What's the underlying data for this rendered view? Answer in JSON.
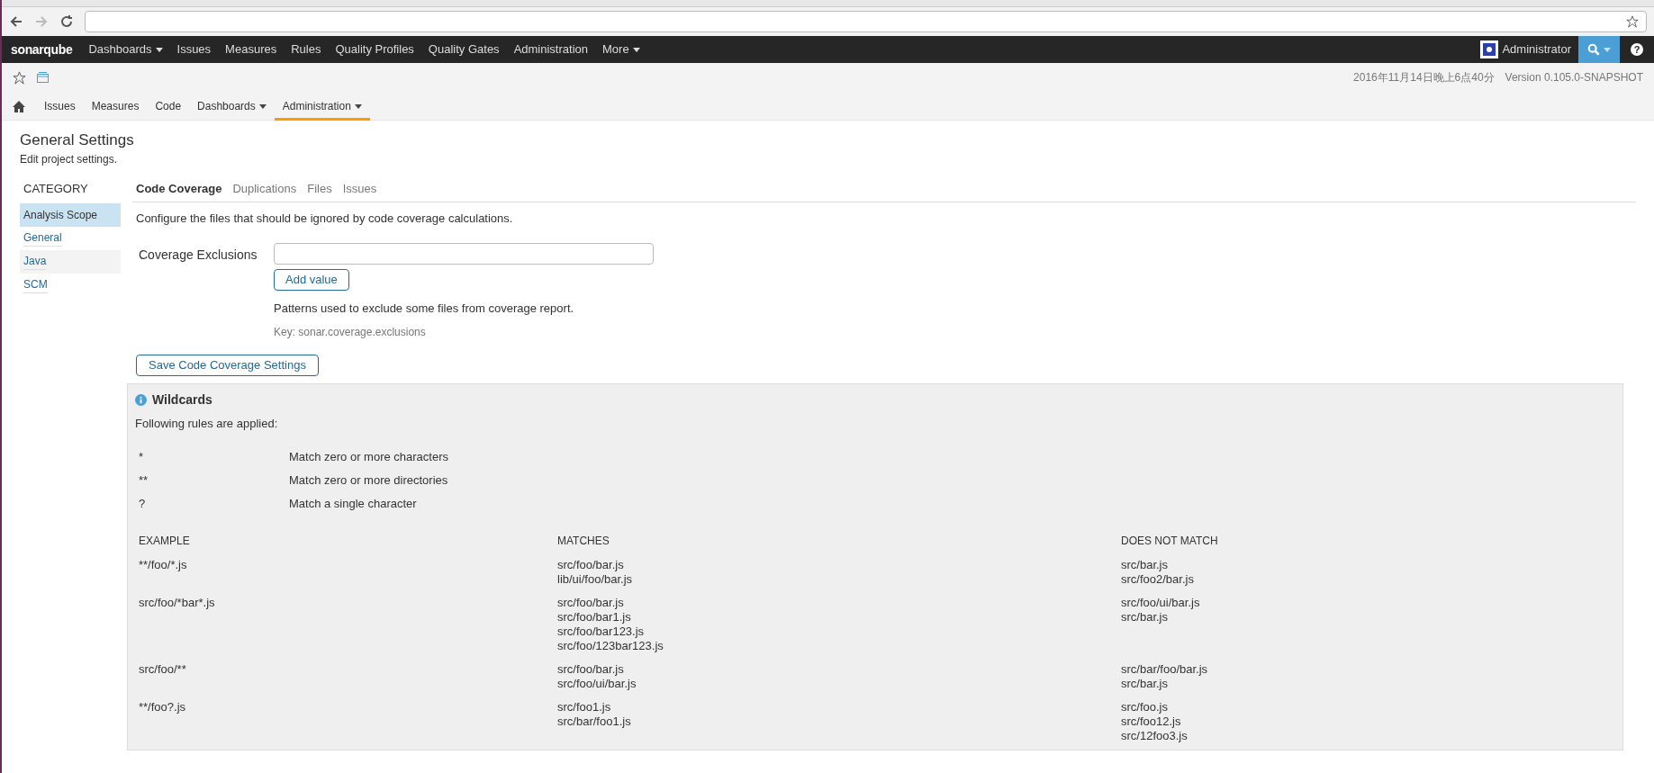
{
  "top_nav": {
    "logo": "sonarqube",
    "items": [
      {
        "label": "Dashboards",
        "dropdown": true
      },
      {
        "label": "Issues",
        "dropdown": false
      },
      {
        "label": "Measures",
        "dropdown": false
      },
      {
        "label": "Rules",
        "dropdown": false
      },
      {
        "label": "Quality Profiles",
        "dropdown": false
      },
      {
        "label": "Quality Gates",
        "dropdown": false
      },
      {
        "label": "Administration",
        "dropdown": false
      },
      {
        "label": "More",
        "dropdown": true
      }
    ],
    "user": "Administrator",
    "help": "?"
  },
  "project_header": {
    "date": "2016年11月14日晚上6点40分",
    "version": "Version 0.105.0-SNAPSHOT"
  },
  "project_nav": [
    {
      "label": "Issues",
      "dropdown": false,
      "selected": false
    },
    {
      "label": "Measures",
      "dropdown": false,
      "selected": false
    },
    {
      "label": "Code",
      "dropdown": false,
      "selected": false
    },
    {
      "label": "Dashboards",
      "dropdown": true,
      "selected": false
    },
    {
      "label": "Administration",
      "dropdown": true,
      "selected": true
    }
  ],
  "page": {
    "title": "General Settings",
    "subtitle": "Edit project settings."
  },
  "category": {
    "heading": "CATEGORY",
    "items": [
      {
        "label": "Analysis Scope",
        "selected": true,
        "hovered": false
      },
      {
        "label": "General",
        "selected": false,
        "hovered": false
      },
      {
        "label": "Java",
        "selected": false,
        "hovered": true
      },
      {
        "label": "SCM",
        "selected": false,
        "hovered": false
      }
    ]
  },
  "tabs": [
    {
      "label": "Code Coverage",
      "selected": true
    },
    {
      "label": "Duplications",
      "selected": false
    },
    {
      "label": "Files",
      "selected": false
    },
    {
      "label": "Issues",
      "selected": false
    }
  ],
  "description": "Configure the files that should be ignored by code coverage calculations.",
  "setting": {
    "label": "Coverage Exclusions",
    "add_button": "Add value",
    "help": "Patterns used to exclude some files from coverage report.",
    "key": "Key: sonar.coverage.exclusions"
  },
  "save_button": "Save Code Coverage Settings",
  "wildcards": {
    "title": "Wildcards",
    "intro": "Following rules are applied:",
    "rules": [
      {
        "pattern": "*",
        "meaning": "Match zero or more characters"
      },
      {
        "pattern": "**",
        "meaning": "Match zero or more directories"
      },
      {
        "pattern": "?",
        "meaning": "Match a single character"
      }
    ],
    "columns": [
      "EXAMPLE",
      "MATCHES",
      "DOES NOT MATCH"
    ],
    "rows": [
      {
        "example": "**/foo/*.js",
        "matches": [
          "src/foo/bar.js",
          "lib/ui/foo/bar.js"
        ],
        "no_match": [
          "src/bar.js",
          "src/foo2/bar.js"
        ]
      },
      {
        "example": "src/foo/*bar*.js",
        "matches": [
          "src/foo/bar.js",
          "src/foo/bar1.js",
          "src/foo/bar123.js",
          "src/foo/123bar123.js"
        ],
        "no_match": [
          "src/foo/ui/bar.js",
          "src/bar.js"
        ]
      },
      {
        "example": "src/foo/**",
        "matches": [
          "src/foo/bar.js",
          "src/foo/ui/bar.js"
        ],
        "no_match": [
          "src/bar/foo/bar.js",
          "src/bar.js"
        ]
      },
      {
        "example": "**/foo?.js",
        "matches": [
          "src/foo1.js",
          "src/bar/foo1.js"
        ],
        "no_match": [
          "src/foo.js",
          "src/foo12.js",
          "src/12foo3.js"
        ]
      }
    ]
  }
}
